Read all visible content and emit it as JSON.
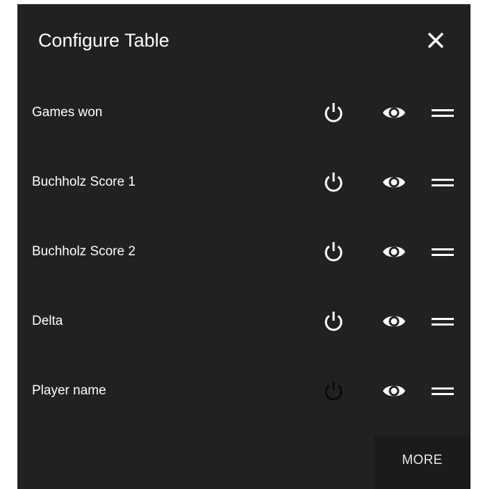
{
  "dialog": {
    "title": "Configure Table",
    "close_icon": "close-icon",
    "more_label": "MORE"
  },
  "rows": [
    {
      "label": "Games won",
      "enabled": true,
      "visible": true
    },
    {
      "label": "Buchholz Score 1",
      "enabled": true,
      "visible": true
    },
    {
      "label": "Buchholz Score 2",
      "enabled": true,
      "visible": true
    },
    {
      "label": "Delta",
      "enabled": true,
      "visible": true
    },
    {
      "label": "Player name",
      "enabled": false,
      "visible": true
    }
  ],
  "icons": {
    "toggle": "power-icon",
    "visibility": "eye-icon",
    "reorder": "drag-handle-icon"
  },
  "colors": {
    "dialog_background": "#212121",
    "text": "#ffffff",
    "icon_active": "#ffffff",
    "icon_inactive": "#0a0a0a",
    "more_button_background": "#1b1b1b"
  }
}
